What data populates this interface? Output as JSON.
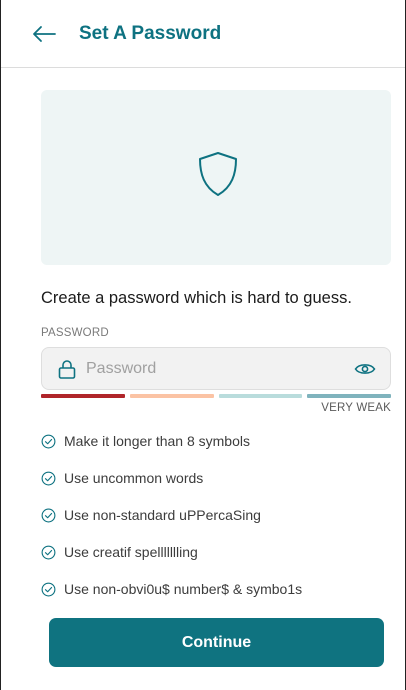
{
  "header": {
    "title": "Set A Password",
    "back_icon": "arrow-left-icon"
  },
  "hero": {
    "icon": "shield-icon"
  },
  "form": {
    "headline": "Create a password which is hard to guess.",
    "password_label": "PASSWORD",
    "password_placeholder": "Password",
    "password_value": "",
    "lock_icon": "lock-icon",
    "toggle_icon": "eye-icon"
  },
  "strength": {
    "level": 1,
    "max_level": 4,
    "label": "VERY WEAK",
    "colors": [
      "#b0252a",
      "#fbc3a4",
      "#b9dcdc",
      "#7fb3bd"
    ]
  },
  "tips": [
    {
      "text": "Make it longer than 8 symbols",
      "icon": "check-circle-icon"
    },
    {
      "text": "Use uncommon words",
      "icon": "check-circle-icon"
    },
    {
      "text": "Use non-standard uPPercaSing",
      "icon": "check-circle-icon"
    },
    {
      "text": "Use creatif spellllllling",
      "icon": "check-circle-icon"
    },
    {
      "text": "Use non-obvi0u$ number$ & symbo1s",
      "icon": "check-circle-icon"
    }
  ],
  "actions": {
    "continue_label": "Continue"
  },
  "colors": {
    "accent": "#0f7380",
    "title": "#0e7281",
    "hero_bg": "#eef5f5"
  }
}
